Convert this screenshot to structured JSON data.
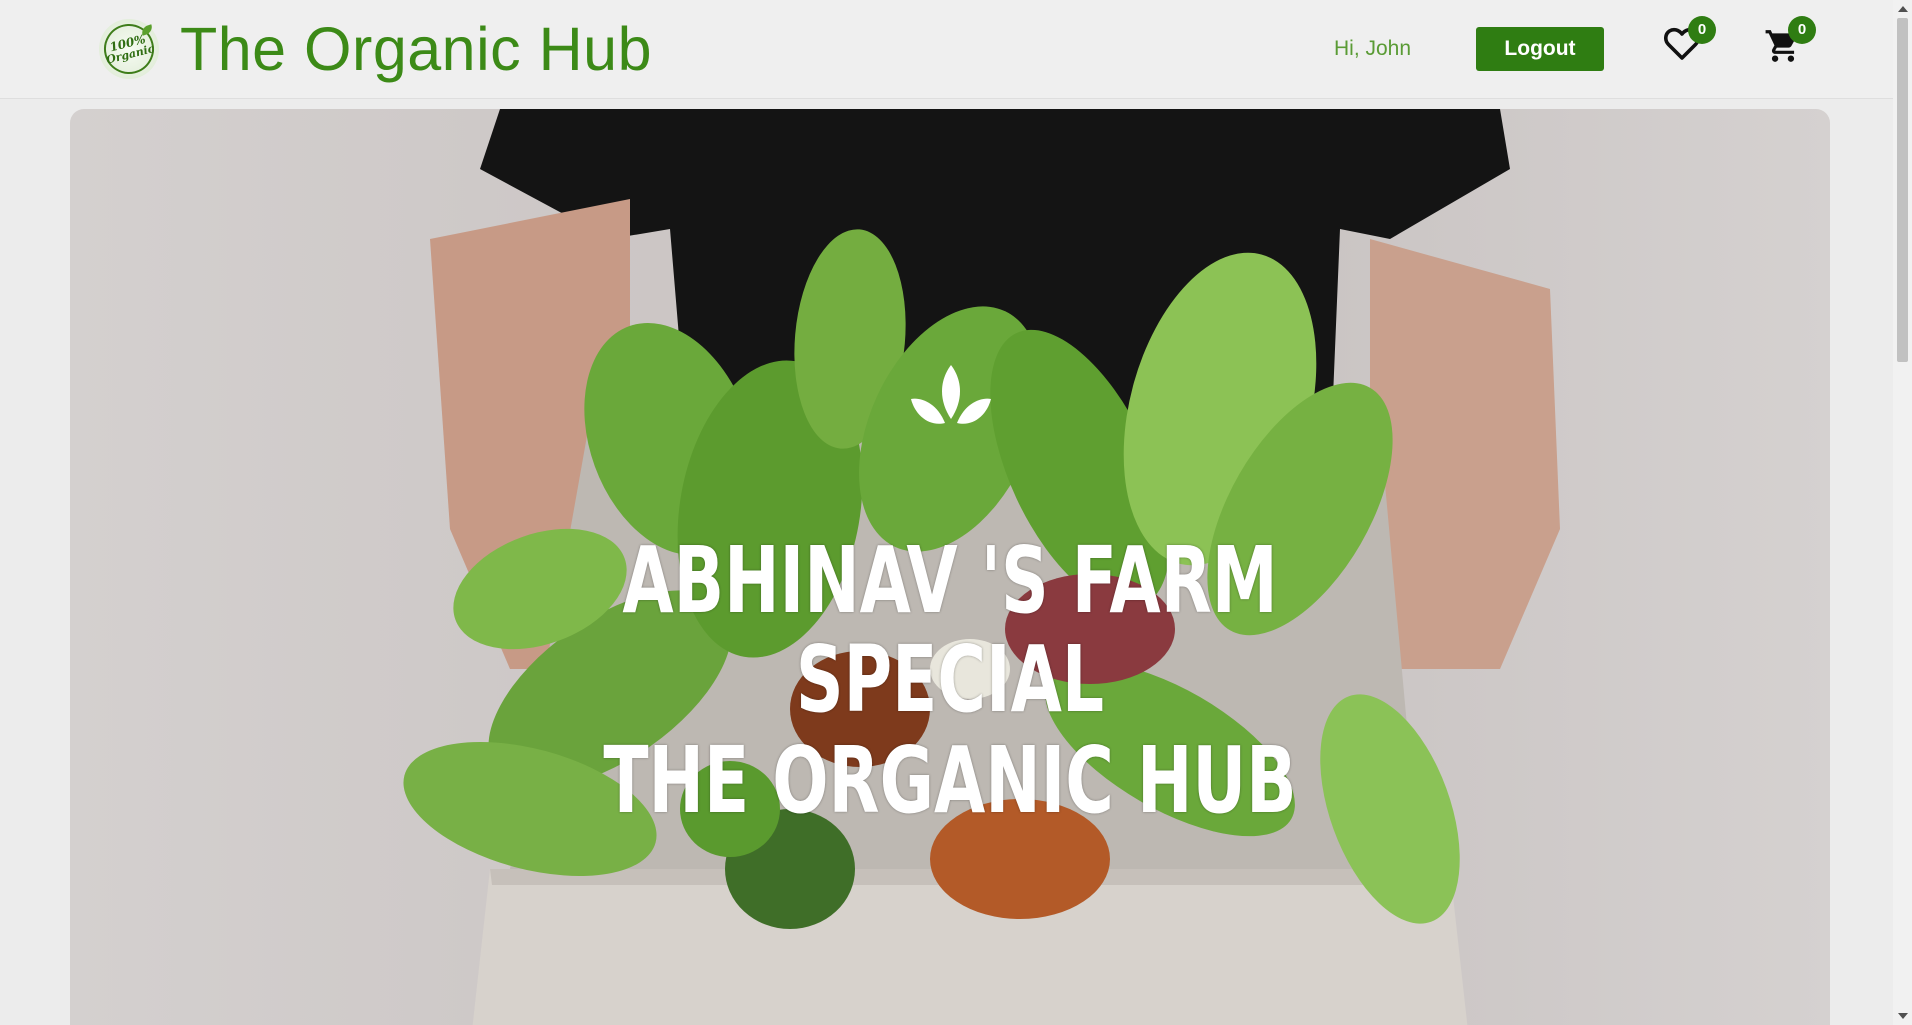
{
  "header": {
    "logo_alt": "100% Organic",
    "logo_pct": "100%",
    "logo_word": "Organic",
    "site_title": "The Organic Hub",
    "greeting": "Hi, John",
    "logout_label": "Logout",
    "wishlist_count": "0",
    "cart_count": "0"
  },
  "hero": {
    "line1": "ABHINAV 'S FARM",
    "line2": "SPECIAL",
    "line3": "THE ORGANIC HUB"
  },
  "colors": {
    "brand_green": "#3c8a17",
    "button_green": "#2f7d12",
    "page_bg": "#ececec"
  },
  "icons": [
    "logo-badge",
    "heart-icon",
    "cart-icon",
    "leaf-icon"
  ]
}
